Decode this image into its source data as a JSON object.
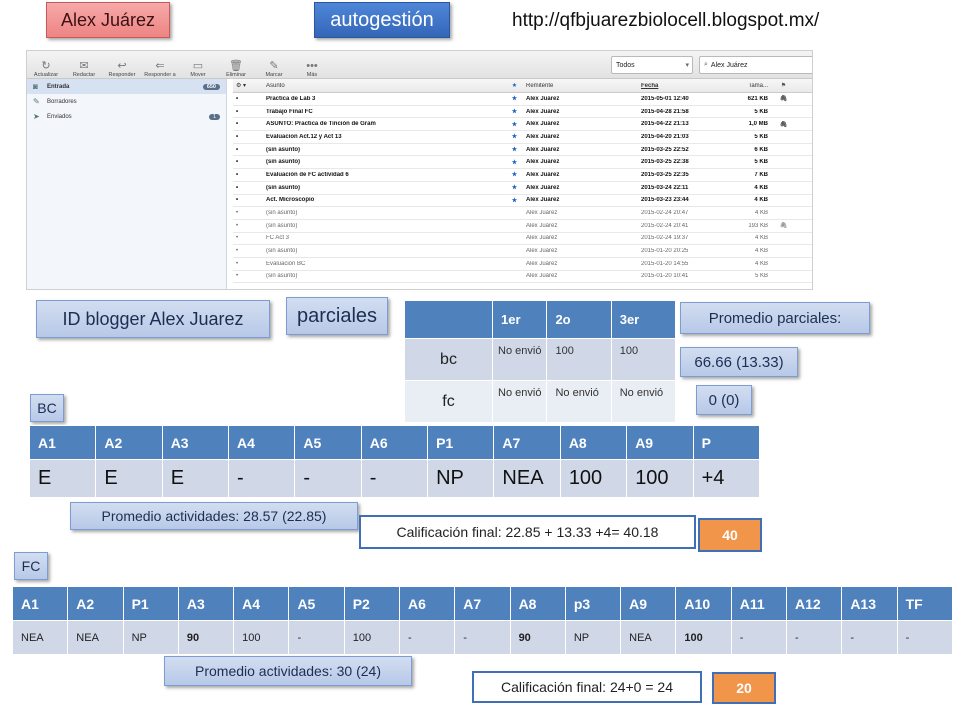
{
  "header": {
    "name": "Alex Juárez",
    "mode": "autogestión",
    "url": "http://qfbjuarezbiolocell.blogspot.mx/"
  },
  "mail": {
    "toolbar": [
      {
        "label": "Actualizar",
        "icon": "refresh-icon",
        "glyph": "↻"
      },
      {
        "label": "Redactar",
        "icon": "compose-icon",
        "glyph": "✉"
      },
      {
        "label": "Responder",
        "icon": "reply-icon",
        "glyph": "↩"
      },
      {
        "label": "Responder a",
        "icon": "reply-all-icon",
        "glyph": "⇐"
      },
      {
        "label": "Mover",
        "icon": "move-icon",
        "glyph": "▭"
      },
      {
        "label": "Eliminar",
        "icon": "delete-icon",
        "glyph": "🗑"
      },
      {
        "label": "Marcar",
        "icon": "mark-icon",
        "glyph": "✎"
      },
      {
        "label": "Más",
        "icon": "more-icon",
        "glyph": "•••"
      }
    ],
    "filter": "Todos",
    "search": "Alex Juárez",
    "folders": [
      {
        "label": "Entrada",
        "count": "650",
        "icon": "inbox-icon",
        "glyph": "◙",
        "selected": true
      },
      {
        "label": "Borradores",
        "count": "",
        "icon": "drafts-icon",
        "glyph": "✎",
        "selected": false
      },
      {
        "label": "Enviados",
        "count": "1",
        "icon": "sent-icon",
        "glyph": "➤",
        "selected": false
      }
    ],
    "columns": {
      "subject": "Asunto",
      "from": "Remitente",
      "date": "Fecha",
      "size": "Tama..."
    },
    "rows": [
      {
        "subject": "Practica de Lab 3",
        "from": "Alex Juárez",
        "date": "2015-05-01 12:40",
        "size": "621 KB",
        "star": true,
        "attach": true,
        "unread": true
      },
      {
        "subject": "Trabajo Final FC",
        "from": "Alex Juárez",
        "date": "2015-04-28 21:58",
        "size": "5 KB",
        "star": true,
        "attach": false,
        "unread": true
      },
      {
        "subject": "ASUNTO: Practica de Tinción de Gram",
        "from": "Alex Juárez",
        "date": "2015-04-22 21:13",
        "size": "1,0 MB",
        "star": true,
        "attach": true,
        "unread": true
      },
      {
        "subject": "Evaluacion Act.12 y Act 13",
        "from": "Alex Juárez",
        "date": "2015-04-20 21:03",
        "size": "5 KB",
        "star": true,
        "attach": false,
        "unread": true
      },
      {
        "subject": "(sin asunto)",
        "from": "Alex Juárez",
        "date": "2015-03-25 22:52",
        "size": "6 KB",
        "star": true,
        "attach": false,
        "unread": true
      },
      {
        "subject": "(sin asunto)",
        "from": "Alex Juárez",
        "date": "2015-03-25 22:38",
        "size": "5 KB",
        "star": true,
        "attach": false,
        "unread": true
      },
      {
        "subject": "Evaluación de FC actividad 6",
        "from": "Alex Juárez",
        "date": "2015-03-25 22:35",
        "size": "7 KB",
        "star": true,
        "attach": false,
        "unread": true
      },
      {
        "subject": "(sin asunto)",
        "from": "Alex Juárez",
        "date": "2015-03-24 22:11",
        "size": "4 KB",
        "star": true,
        "attach": false,
        "unread": true
      },
      {
        "subject": "Act. Microscopio",
        "from": "Alex Juárez",
        "date": "2015-03-23 23:44",
        "size": "4 KB",
        "star": true,
        "attach": false,
        "unread": true
      },
      {
        "subject": "(sin asunto)",
        "from": "Alex Juárez",
        "date": "2015-02-24 20:47",
        "size": "4 KB",
        "star": false,
        "attach": false,
        "unread": false
      },
      {
        "subject": "(sin asunto)",
        "from": "Alex Juárez",
        "date": "2015-02-24 20:41",
        "size": "193 KB",
        "star": false,
        "attach": true,
        "unread": false
      },
      {
        "subject": "FC Act 3",
        "from": "Alex Juárez",
        "date": "2015-02-24 19:37",
        "size": "4 KB",
        "star": false,
        "attach": false,
        "unread": false
      },
      {
        "subject": "(sin asunto)",
        "from": "Alex Juárez",
        "date": "2015-01-20 20:25",
        "size": "4 KB",
        "star": false,
        "attach": false,
        "unread": false
      },
      {
        "subject": "Evaluación BC",
        "from": "Alex Juárez",
        "date": "2015-01-20 14:55",
        "size": "4 KB",
        "star": false,
        "attach": false,
        "unread": false
      },
      {
        "subject": "(sin asunto)",
        "from": "Alex Juárez",
        "date": "2015-01-20 10:41",
        "size": "5 KB",
        "star": false,
        "attach": false,
        "unread": false
      }
    ]
  },
  "labels": {
    "blogger_id": "ID blogger Alex Juarez",
    "parciales": "parciales",
    "promedio_parciales": "Promedio parciales:",
    "promedio_bc": "66.66 (13.33)",
    "promedio_fc": "0 (0)"
  },
  "parciales_table": {
    "headers": [
      "",
      "1er",
      "2o",
      "3er"
    ],
    "rows": [
      {
        "label": "bc",
        "cells": [
          "No envió",
          "100",
          "100"
        ]
      },
      {
        "label": "fc",
        "cells": [
          "No envió",
          "No envió",
          "No envió"
        ]
      }
    ]
  },
  "bc": {
    "tag": "BC",
    "headers": [
      "A1",
      "A2",
      "A3",
      "A4",
      "A5",
      "A6",
      "P1",
      "A7",
      "A8",
      "A9",
      "P"
    ],
    "values": [
      "E",
      "E",
      "E",
      "-",
      "-",
      "-",
      "NP",
      "NEA",
      "100",
      "100",
      "+4"
    ],
    "promedio": "Promedio actividades: 28.57 (22.85)",
    "calificacion": "Calificación final: 22.85 + 13.33 +4= 40.18",
    "final": "40"
  },
  "fc": {
    "tag": "FC",
    "headers": [
      "A1",
      "A2",
      "P1",
      "A3",
      "A4",
      "A5",
      "P2",
      "A6",
      "A7",
      "A8",
      "p3",
      "A9",
      "A10",
      "A11",
      "A12",
      "A13",
      "TF"
    ],
    "values": [
      "NEA",
      "NEA",
      "NP",
      "90",
      "100",
      "-",
      "100",
      "-",
      "-",
      "90",
      "NP",
      "NEA",
      "100",
      "-",
      "-",
      "-",
      "-"
    ],
    "bold": [
      false,
      false,
      false,
      true,
      false,
      false,
      false,
      false,
      false,
      true,
      false,
      false,
      true,
      false,
      false,
      false,
      false
    ],
    "promedio": "Promedio actividades: 30 (24)",
    "calificacion": "Calificación final: 24+0 = 24",
    "final": "20"
  },
  "colors": {
    "header_blue": "#4f81bd",
    "cell_light": "#d0d8e8",
    "orange": "#f0954a",
    "tag_blue": "#b7c9e8",
    "tag_red": "#ee8484"
  }
}
